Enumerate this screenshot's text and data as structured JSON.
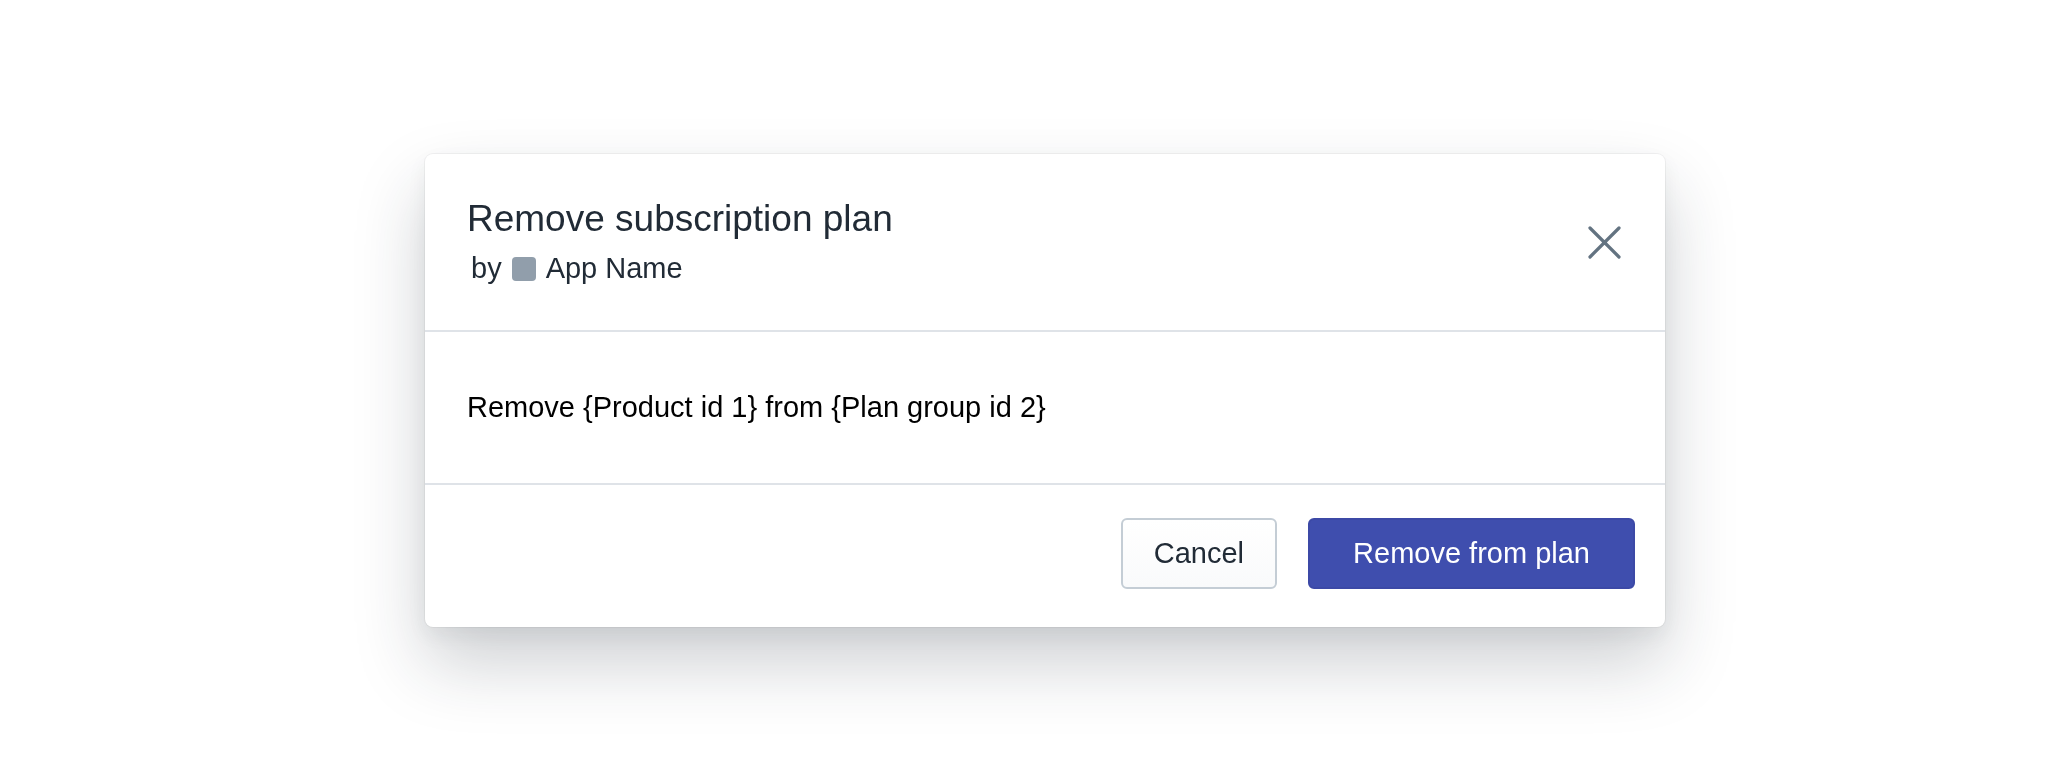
{
  "dialog": {
    "title": "Remove subscription plan",
    "byline": {
      "prefix": "by",
      "app_name": "App Name"
    },
    "message": "Remove {Product id 1} from {Plan group id 2}",
    "buttons": [
      {
        "label": "Cancel",
        "kind": "secondary"
      },
      {
        "label": "Remove from plan",
        "kind": "primary"
      }
    ]
  }
}
